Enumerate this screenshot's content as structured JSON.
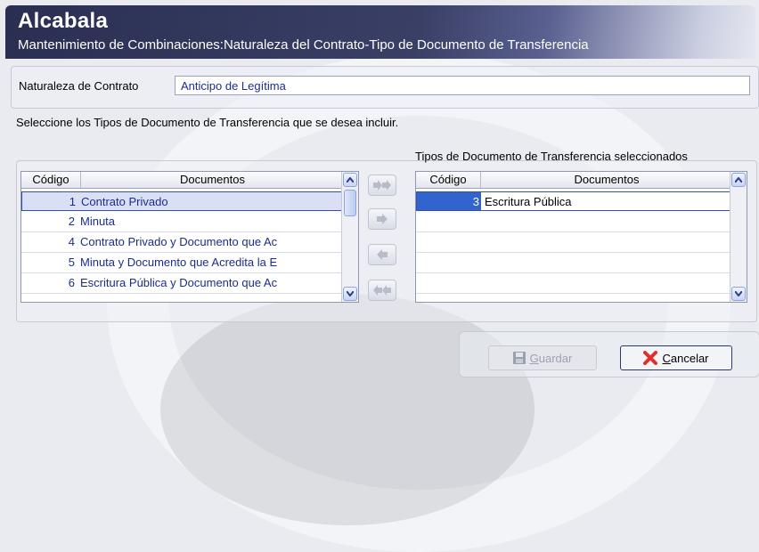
{
  "header": {
    "title": "Alcabala",
    "subtitle": "Mantenimiento de Combinaciones:Naturaleza del Contrato-Tipo de Documento de Transferencia"
  },
  "naturaleza": {
    "label": "Naturaleza de Contrato",
    "value": "Anticipo de Legítima"
  },
  "instruction": "Seleccione los Tipos de Documento de Transferencia que se desea incluir.",
  "left_grid": {
    "columns": [
      "Código",
      "Documentos"
    ],
    "rows": [
      {
        "code": "1",
        "doc": "Contrato Privado"
      },
      {
        "code": "2",
        "doc": "Minuta"
      },
      {
        "code": "4",
        "doc": "Contrato Privado y Documento que Ac"
      },
      {
        "code": "5",
        "doc": "Minuta y Documento que Acredita la E"
      },
      {
        "code": "6",
        "doc": "Escritura Pública y Documento que Ac"
      }
    ]
  },
  "right_grid": {
    "title": "Tipos de Documento de Transferencia seleccionados",
    "columns": [
      "Código",
      "Documentos"
    ],
    "rows": [
      {
        "code": "3",
        "doc": "Escritura Pública"
      }
    ]
  },
  "buttons": {
    "save_prefix": "",
    "save_underline": "G",
    "save_rest": "uardar",
    "cancel_underline": "C",
    "cancel_rest": "ancelar"
  },
  "colors": {
    "header_dark": "#2a2f52",
    "text_blue": "#1c2d8a",
    "selection_blue": "#3363cc"
  }
}
